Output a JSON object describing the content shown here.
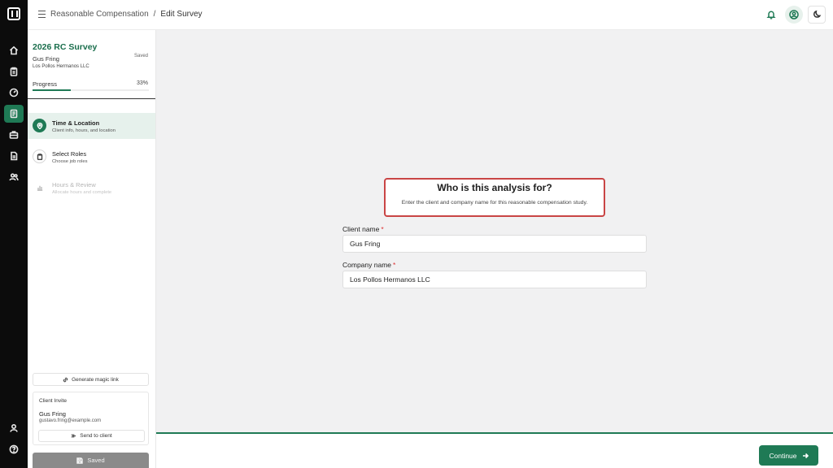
{
  "breadcrumb": {
    "parent": "Reasonable Compensation",
    "separator": "/",
    "current": "Edit Survey"
  },
  "survey": {
    "title": "2026 RC Survey",
    "client": "Gus Fring",
    "company": "Los Pollos Hermanos LLC",
    "saved_status": "Saved",
    "progress_label": "Progress",
    "progress_text": "33%",
    "progress_percent": 33
  },
  "steps": [
    {
      "title": "Time & Location",
      "subtitle": "Client info, hours, and location",
      "state": "active",
      "icon": "location-pin-icon"
    },
    {
      "title": "Select Roles",
      "subtitle": "Choose job roles",
      "state": "pending",
      "icon": "clipboard-icon"
    },
    {
      "title": "Hours & Review",
      "subtitle": "Allocate hours and complete",
      "state": "disabled",
      "icon": "bar-chart-icon"
    }
  ],
  "actions": {
    "magic_link": "Generate magic link",
    "saved_button": "Saved"
  },
  "invite": {
    "heading": "Client Invite",
    "name": "Gus Fring",
    "email": "gustavo.fring@example.com",
    "send_button": "Send to client"
  },
  "question": {
    "title": "Who is this analysis for?",
    "subtitle": "Enter the client and company name for this reasonable compensation study."
  },
  "form": {
    "client_label": "Client name",
    "client_value": "Gus Fring",
    "company_label": "Company name",
    "company_value": "Los Pollos Hermanos LLC",
    "required_mark": "*"
  },
  "footer": {
    "continue_label": "Continue"
  },
  "colors": {
    "accent": "#1f7a55",
    "rail": "#0c0c0c",
    "highlight_border": "#c94545",
    "disabled_button": "#8a8a8a"
  },
  "rail_icons": [
    "home-icon",
    "clipboard-icon",
    "gauge-icon",
    "survey-icon",
    "briefcase-icon",
    "document-icon",
    "users-icon",
    "user-icon",
    "help-icon"
  ]
}
